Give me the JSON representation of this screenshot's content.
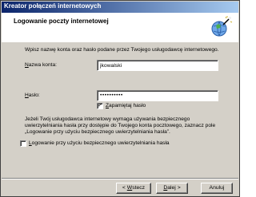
{
  "window": {
    "title": "Kreator połączeń internetowych"
  },
  "header": {
    "title": "Logowanie poczty internetowej",
    "icon": "globe-wand-icon"
  },
  "intro": "Wpisz nazwę konta oraz hasło podane przez Twojego usługodawcę internetowego.",
  "form": {
    "account_label": "Nazwa konta:",
    "account_value": "jkowalski",
    "password_label": "Hasło:",
    "password_value": "••••••••••",
    "remember_label": "Zapamiętaj hasło",
    "remember_checked": true
  },
  "spa": {
    "text": "Jeżeli Twój usługodawca internetowy wymaga używania bezpiecznego uwierzytelniania hasła przy dostępie do Twojego konta pocztowego, zaznacz pole „Logowanie przy użyciu bezpiecznego uwierzytelniania hasła”.",
    "checkbox_label": "Logowanie przy użyciu bezpiecznego uwierzytelniania hasła",
    "checked": false
  },
  "buttons": {
    "back": "< Wstecz",
    "next": "Dalej >",
    "cancel": "Anuluj"
  }
}
